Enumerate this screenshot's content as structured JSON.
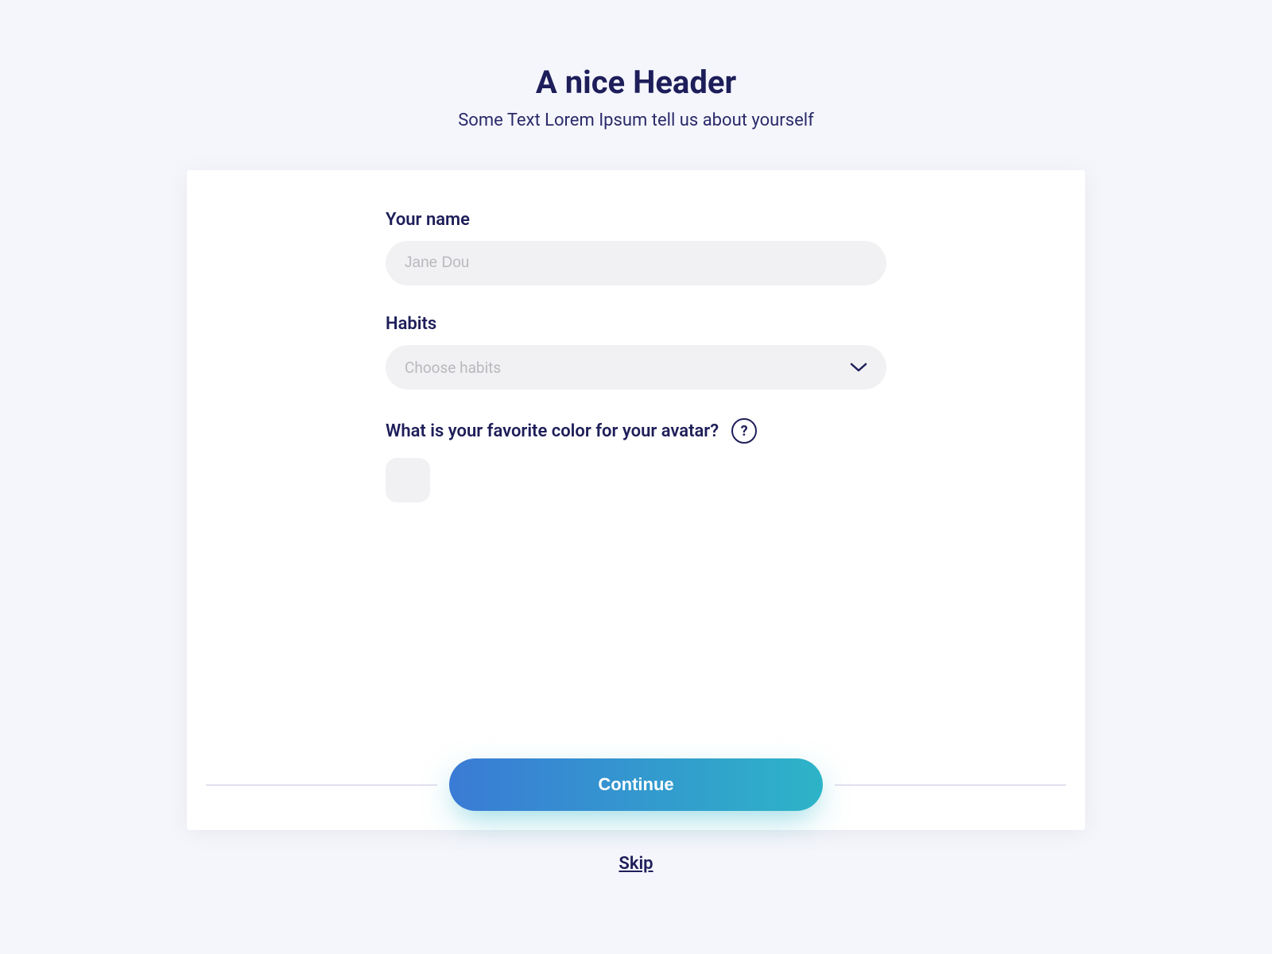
{
  "header": {
    "title": "A nice Header",
    "subtitle": "Some Text Lorem Ipsum tell us about yourself"
  },
  "form": {
    "name": {
      "label": "Your name",
      "placeholder": "Jane Dou",
      "value": ""
    },
    "habits": {
      "label": "Habits",
      "placeholder": "Choose habits"
    },
    "color_question": {
      "label": "What is your favorite color for your avatar?",
      "help_symbol": "?"
    }
  },
  "actions": {
    "continue_label": "Continue",
    "skip_label": "Skip"
  }
}
